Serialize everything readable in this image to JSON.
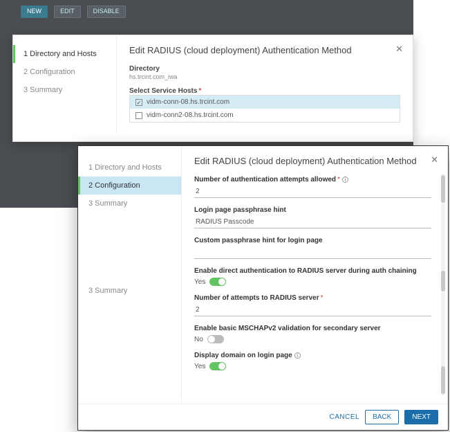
{
  "topbar": {
    "new": "NEW",
    "b2": "EDIT",
    "b3": "DISABLE"
  },
  "steps": {
    "s1": "1 Directory and Hosts",
    "s2": "2 Configuration",
    "s3": "3 Summary"
  },
  "back": {
    "title": "Edit RADIUS (cloud deployment) Authentication Method",
    "directory_label": "Directory",
    "directory_value": "hs.trcint.com_iwa",
    "hosts_label": "Select Service Hosts",
    "host1": "vidm-conn-08.hs.trcint.com",
    "host2": "vidm-conn2-08.hs.trcint.com"
  },
  "front": {
    "title": "Edit RADIUS (cloud deployment) Authentication Method",
    "f1_label": "Number of authentication attempts allowed",
    "f1_value": "2",
    "f2_label": "Login page passphrase hint",
    "f2_value": "RADIUS Passcode",
    "f3_label": "Custom passphrase hint for login page",
    "f3_value": "",
    "f4_label": "Enable direct authentication to RADIUS server during auth chaining",
    "f4_state": "Yes",
    "f5_label": "Number of attempts to RADIUS server",
    "f5_value": "2",
    "f6_label": "Enable basic MSCHAPv2 validation for secondary server",
    "f6_state": "No",
    "f7_label": "Display domain on login page",
    "f7_state": "Yes"
  },
  "footer": {
    "cancel": "CANCEL",
    "back": "BACK",
    "next": "NEXT"
  }
}
